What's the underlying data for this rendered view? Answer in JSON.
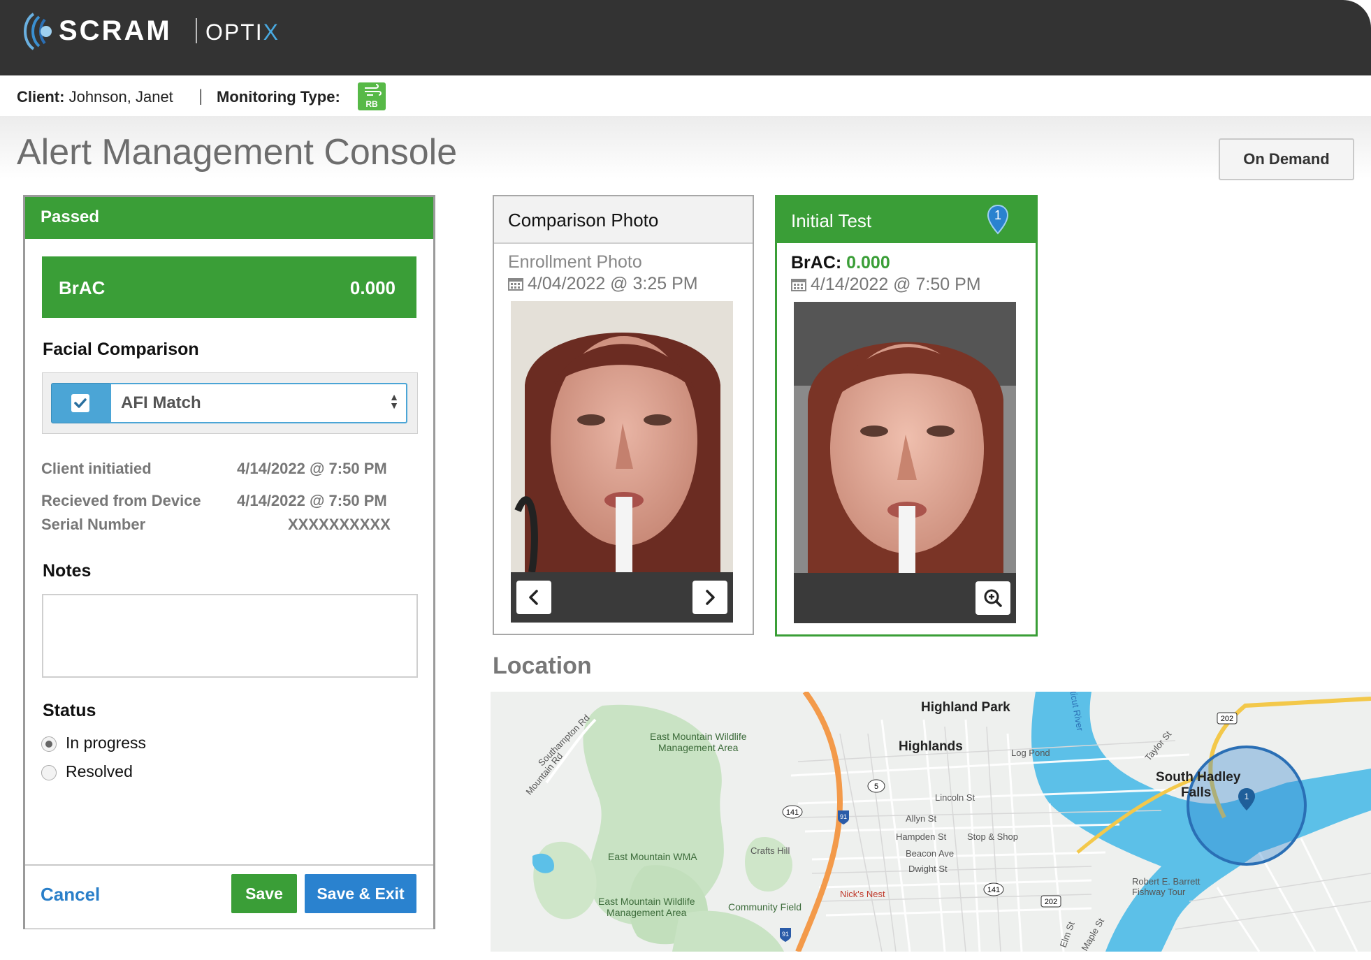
{
  "header": {
    "brand": "SCRAM",
    "product_prefix": "OPTI",
    "product_suffix": "X"
  },
  "clientbar": {
    "client_label": "Client:",
    "client_name": "Johnson, Janet",
    "separator": "|",
    "monitoring_label": "Monitoring Type:",
    "monitoring_badge": "RB"
  },
  "page": {
    "title": "Alert Management Console",
    "on_demand_label": "On Demand"
  },
  "alert_panel": {
    "status_header": "Passed",
    "brac_label": "BrAC",
    "brac_value": "0.000",
    "facial_heading": "Facial Comparison",
    "facial_select_value": "AFI Match",
    "meta": [
      {
        "label": "Client initiatied",
        "value": "4/14/2022 @ 7:50 PM"
      },
      {
        "label": "Recieved from Device",
        "value": "4/14/2022 @ 7:50 PM"
      },
      {
        "label": "Serial Number",
        "value": "XXXXXXXXXX"
      }
    ],
    "notes_heading": "Notes",
    "notes_value": "",
    "status_heading": "Status",
    "status_options": [
      {
        "label": "In progress",
        "selected": true
      },
      {
        "label": "Resolved",
        "selected": false
      }
    ],
    "cancel_label": "Cancel",
    "save_label": "Save",
    "save_exit_label": "Save & Exit"
  },
  "comparison_card": {
    "title": "Comparison Photo",
    "subtitle": "Enrollment Photo",
    "datetime": "4/04/2022 @ 3:25 PM"
  },
  "initial_card": {
    "title": "Initial Test",
    "pin_number": "1",
    "brac_label": "BrAC:",
    "brac_value": "0.000",
    "datetime": "4/14/2022 @ 7:50 PM"
  },
  "location": {
    "title": "Location",
    "marker_number": "1",
    "labels": {
      "highland_park": "Highland Park",
      "highlands": "Highlands",
      "log_pond": "Log Pond",
      "south_hadley": "South Hadley",
      "falls": "Falls",
      "lincoln": "Lincoln St",
      "allyn": "Allyn St",
      "hampden": "Hampden St",
      "stop_shop": "Stop & Shop",
      "beacon": "Beacon Ave",
      "dwight": "Dwight St",
      "crafts_hill": "Crafts Hill",
      "east_mtn_wma": "East Mountain WMA",
      "emwma_top_1": "East Mountain Wildlife",
      "emwma_top_2": "Management Area",
      "emwma_bot_1": "East Mountain Wildlife",
      "emwma_bot_2": "Management Area",
      "community_field": "Community Field",
      "nicks_nest": "Nick's Nest",
      "southampton": "Southampton Rd",
      "mountain_rd": "Mountain Rd",
      "taylor": "Taylor St",
      "barrett_1": "Robert E. Barrett",
      "barrett_2": "Fishway Tour",
      "elm": "Elm St",
      "maple": "Maple St",
      "river": "ticut River",
      "r141a": "141",
      "r141b": "141",
      "r5": "5",
      "r91a": "91",
      "r91b": "91",
      "r202a": "202",
      "r202b": "202"
    }
  }
}
